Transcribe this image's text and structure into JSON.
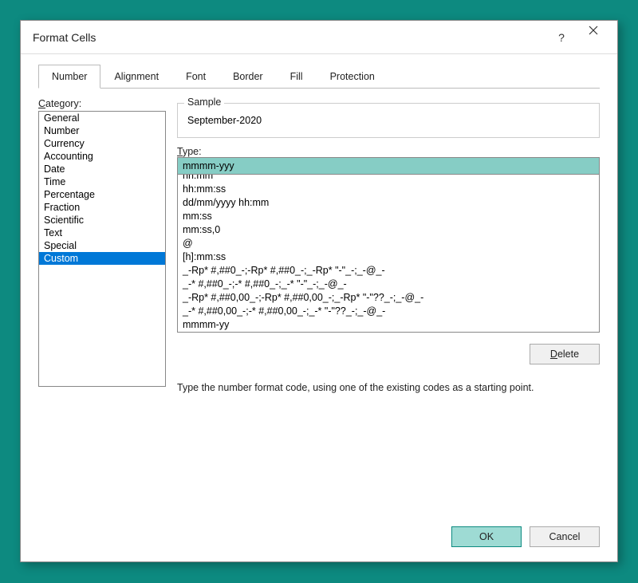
{
  "dialog": {
    "title": "Format Cells",
    "help_tooltip": "?",
    "tabs": [
      {
        "label": "Number"
      },
      {
        "label": "Alignment"
      },
      {
        "label": "Font"
      },
      {
        "label": "Border"
      },
      {
        "label": "Fill"
      },
      {
        "label": "Protection"
      }
    ],
    "active_tab": "Number"
  },
  "category": {
    "label": "Category:",
    "items": [
      "General",
      "Number",
      "Currency",
      "Accounting",
      "Date",
      "Time",
      "Percentage",
      "Fraction",
      "Scientific",
      "Text",
      "Special",
      "Custom"
    ],
    "selected": "Custom"
  },
  "sample": {
    "label": "Sample",
    "value": "September-2020"
  },
  "type": {
    "label": "Type:",
    "value": "mmmm-yyy"
  },
  "format_list": [
    "hh:mm",
    "hh:mm:ss",
    "dd/mm/yyyy hh:mm",
    "mm:ss",
    "mm:ss,0",
    "@",
    "[h]:mm:ss",
    "_-Rp* #,##0_-;-Rp* #,##0_-;_-Rp* \"-\"_-;_-@_-",
    "_-* #,##0_-;-* #,##0_-;_-* \"-\"_-;_-@_-",
    "_-Rp* #,##0,00_-;-Rp* #,##0,00_-;_-Rp* \"-\"??_-;_-@_-",
    "_-* #,##0,00_-;-* #,##0,00_-;_-* \"-\"??_-;_-@_-",
    "mmmm-yy"
  ],
  "buttons": {
    "delete": "Delete",
    "ok": "OK",
    "cancel": "Cancel"
  },
  "hint": "Type the number format code, using one of the existing codes as a starting point."
}
